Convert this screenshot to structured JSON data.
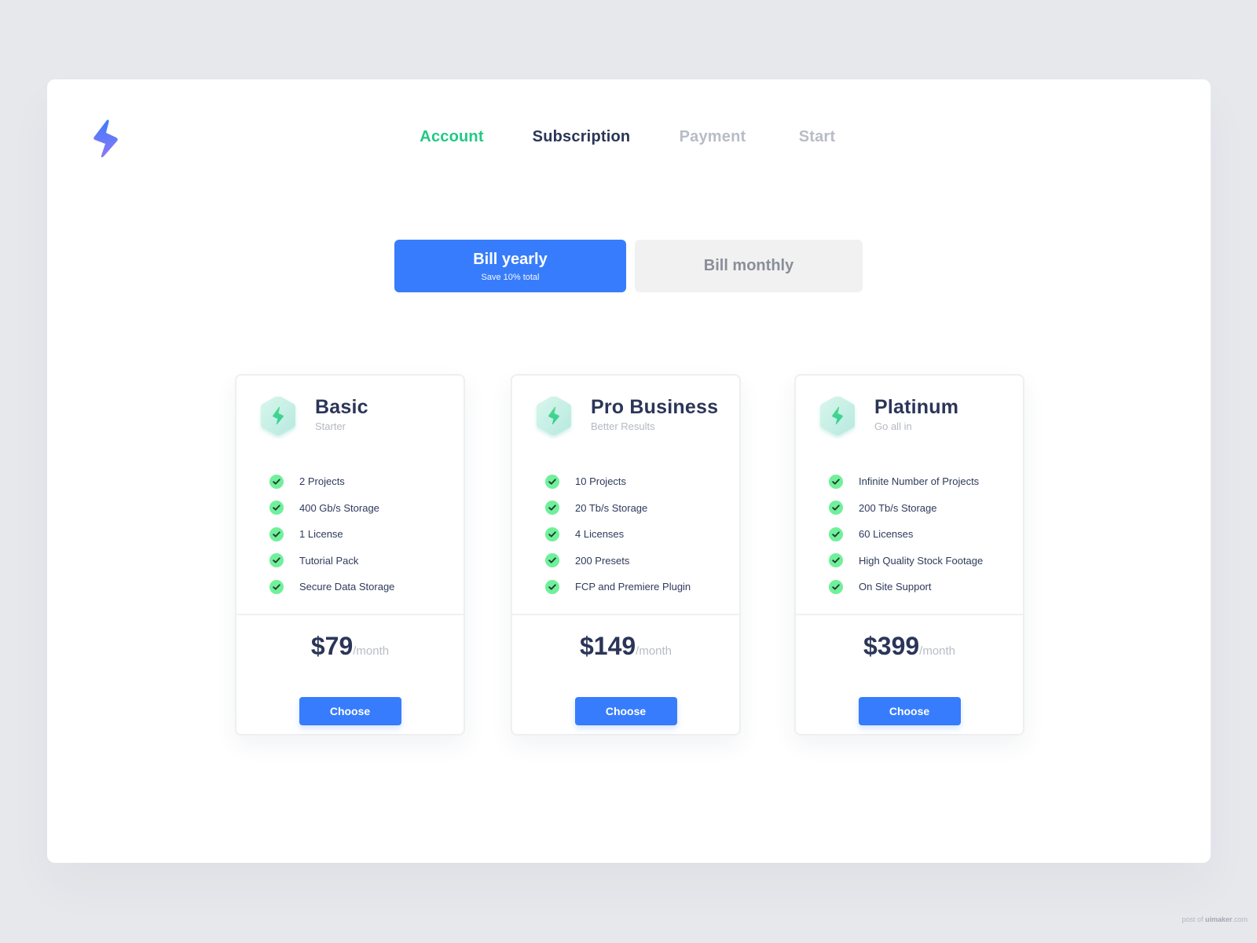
{
  "app": {
    "logo_icon": "lightning-bolt-icon",
    "brand_gradient": [
      "#3c7cfb",
      "#8d78f7"
    ]
  },
  "steps": [
    {
      "label": "Account",
      "state": "done"
    },
    {
      "label": "Subscription",
      "state": "active"
    },
    {
      "label": "Payment",
      "state": "pending"
    },
    {
      "label": "Start",
      "state": "pending"
    }
  ],
  "billing": {
    "yearly": {
      "label": "Bill yearly",
      "sub": "Save 10% total",
      "selected": true
    },
    "monthly": {
      "label": "Bill monthly",
      "selected": false
    }
  },
  "plans": [
    {
      "name": "Basic",
      "tagline": "Starter",
      "icon": "lightning-hexagon-icon",
      "features": [
        "2 Projects",
        "400 Gb/s Storage",
        "1 License",
        "Tutorial Pack",
        "Secure Data Storage"
      ],
      "price": "$79",
      "period": "/month",
      "cta": "Choose"
    },
    {
      "name": "Pro Business",
      "tagline": "Better Results",
      "icon": "lightning-hexagon-icon",
      "features": [
        "10 Projects",
        "20 Tb/s Storage",
        "4 Licenses",
        "200 Presets",
        "FCP and Premiere Plugin"
      ],
      "price": "$149",
      "period": "/month",
      "cta": "Choose"
    },
    {
      "name": "Platinum",
      "tagline": "Go all in",
      "icon": "lightning-hexagon-icon",
      "features": [
        "Infinite Number of Projects",
        "200 Tb/s Storage",
        "60 Licenses",
        "High Quality Stock Footage",
        "On Site Support"
      ],
      "price": "$399",
      "period": "/month",
      "cta": "Choose"
    }
  ],
  "colors": {
    "accent": "#377cfc",
    "success": "#21c985",
    "check": "#6ff09a",
    "heading": "#2b3558",
    "muted": "#b8bcc6"
  },
  "watermark": {
    "prefix": "post of ",
    "brand": "uimaker",
    "suffix": ".com"
  }
}
